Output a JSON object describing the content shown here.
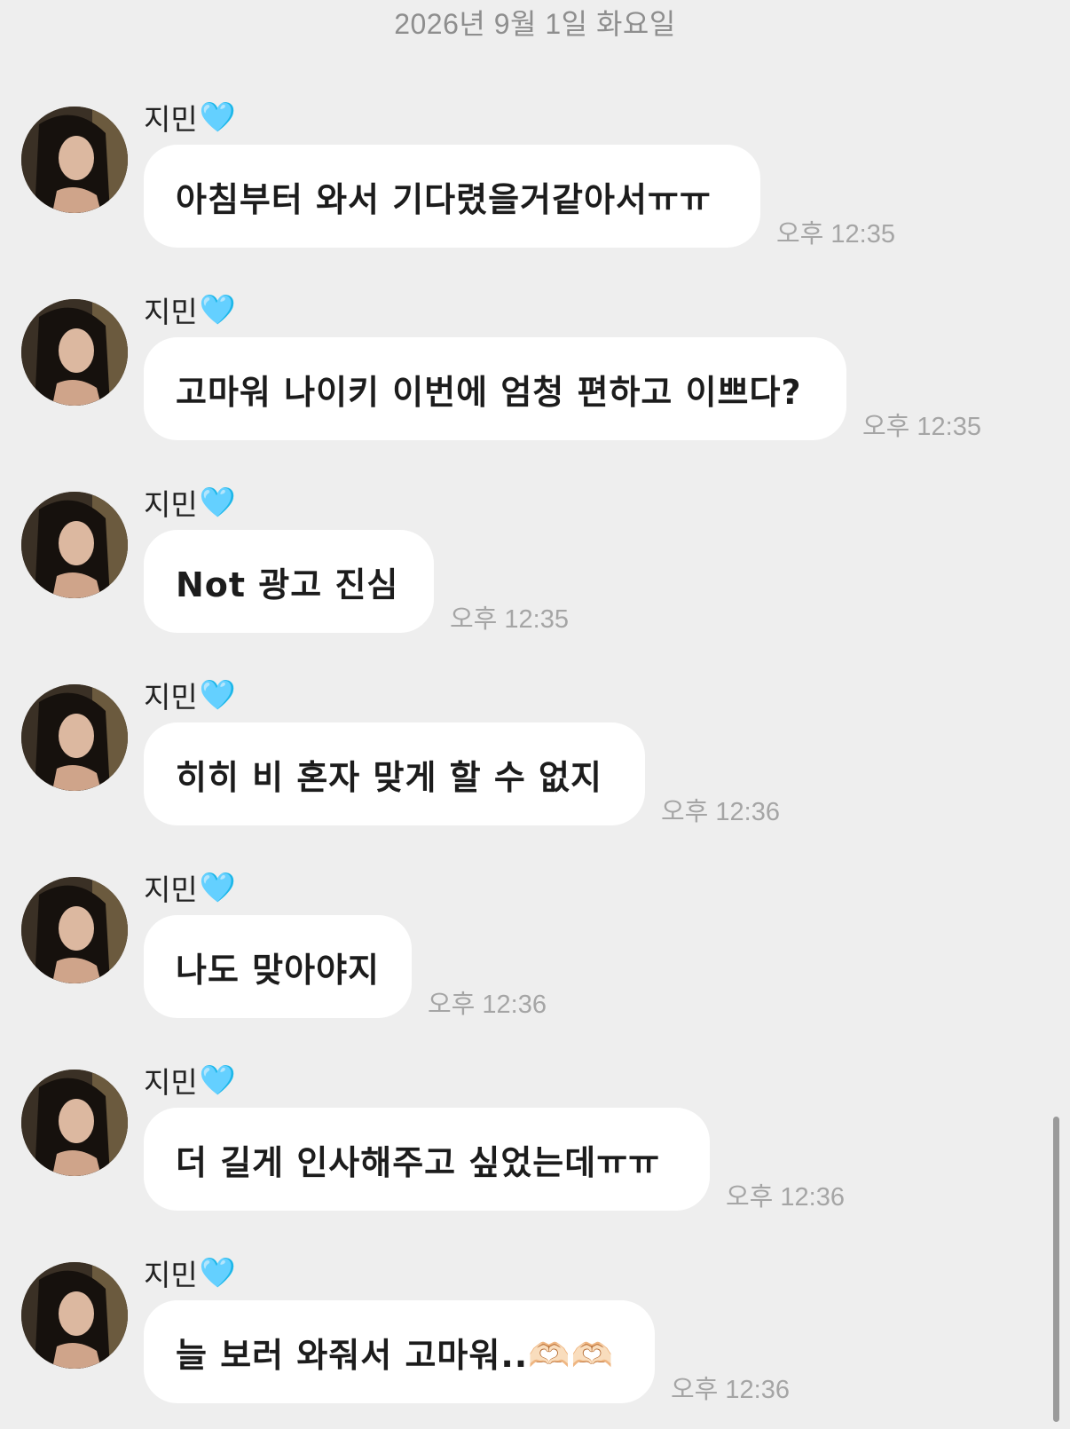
{
  "date_header": "2026년 9월 1일 화요일",
  "sender": {
    "name": "지민",
    "heart": "🩵"
  },
  "messages": [
    {
      "text": "아침부터 와서 기다렸을거같아서ㅠㅠ",
      "time": "오후 12:35"
    },
    {
      "text": "고마워 나이키 이번에 엄청 편하고 이쁘다?",
      "time": "오후 12:35"
    },
    {
      "text": "Not 광고 진심",
      "time": "오후 12:35"
    },
    {
      "text": "히히 비 혼자 맞게 할 수 없지",
      "time": "오후 12:36"
    },
    {
      "text": "나도 맞아야지",
      "time": "오후 12:36"
    },
    {
      "text": "더 길게 인사해주고 싶었는데ㅠㅠ",
      "time": "오후 12:36"
    },
    {
      "text": "늘 보러 와줘서 고마워..🫶🏻🫶🏻",
      "time": "오후 12:36"
    }
  ]
}
